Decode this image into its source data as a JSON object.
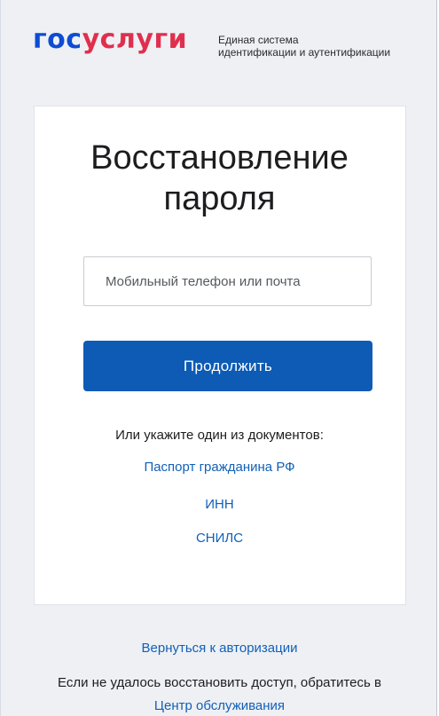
{
  "header": {
    "logo_part1": "гос",
    "logo_part2": "услуги",
    "tagline_line1": "Единая система",
    "tagline_line2": "идентификации и аутентификации"
  },
  "form": {
    "title_line1": "Восстановление",
    "title_line2": "пароля",
    "input_placeholder": "Мобильный телефон или почта",
    "input_value": "",
    "submit_label": "Продолжить"
  },
  "documents": {
    "hint": "Или укажите один из документов:",
    "links": [
      {
        "label": "Паспорт гражданина РФ"
      },
      {
        "label": "ИНН"
      },
      {
        "label": "СНИЛС"
      }
    ]
  },
  "footer": {
    "back_link": "Вернуться к авторизации",
    "help_text": "Если не удалось восстановить доступ, обратитесь в",
    "service_center_link": "Центр обслуживания"
  },
  "colors": {
    "brand_blue": "#0d4cd3",
    "brand_red": "#e02f4d",
    "button_bg": "#0d5bb5",
    "link": "#1160b8",
    "page_bg": "#eef0f4"
  }
}
